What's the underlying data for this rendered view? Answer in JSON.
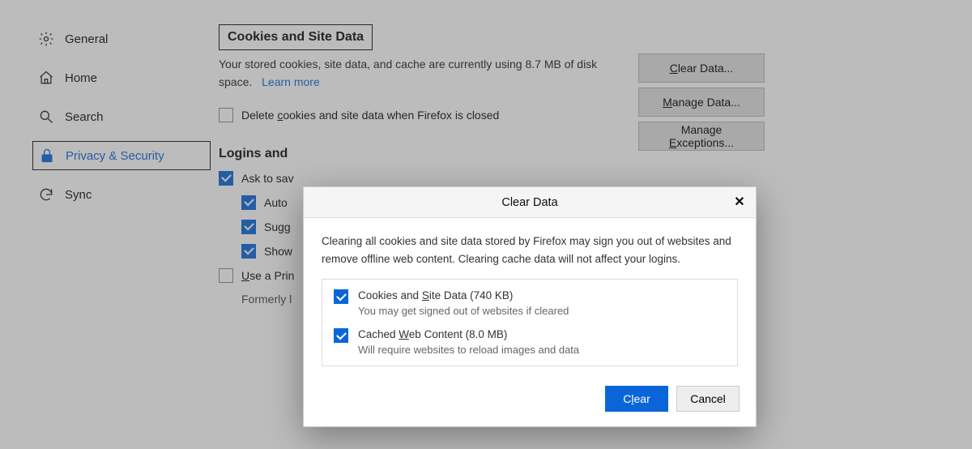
{
  "sidebar": {
    "general": "General",
    "home": "Home",
    "search": "Search",
    "privacy": "Privacy & Security",
    "sync": "Sync"
  },
  "cookies": {
    "heading": "Cookies and Site Data",
    "desc_pre": "Your stored cookies, site data, and cache are currently using 8.7 MB of disk space.",
    "learn_more": "Learn more",
    "delete_on_close_pre": "Delete ",
    "delete_on_close_u": "c",
    "delete_on_close_post": "ookies and site data when Firefox is closed",
    "clear_data_pre": "",
    "clear_data_u": "C",
    "clear_data_post": "lear Data...",
    "manage_data_pre": "",
    "manage_data_u": "M",
    "manage_data_post": "anage Data...",
    "manage_ex_pre": "Manage ",
    "manage_ex_u": "E",
    "manage_ex_post": "xceptions..."
  },
  "logins": {
    "heading": "Logins and",
    "ask": "Ask to sav",
    "autofill": "Auto",
    "suggest": "Sugg",
    "show": "Show",
    "use_primary_pre": "",
    "use_primary_u": "U",
    "use_primary_post": "se a Prin",
    "formerly": "Formerly l"
  },
  "dialog": {
    "title": "Clear Data",
    "intro": "Clearing all cookies and site data stored by Firefox may sign you out of websites and remove offline web content. Clearing cache data will not affect your logins.",
    "opt1_label_pre": "Cookies and ",
    "opt1_label_u": "S",
    "opt1_label_post": "ite Data (740 KB)",
    "opt1_sub": "You may get signed out of websites if cleared",
    "opt2_label_pre": "Cached ",
    "opt2_label_u": "W",
    "opt2_label_post": "eb Content (8.0 MB)",
    "opt2_sub": "Will require websites to reload images and data",
    "clear_pre": "C",
    "clear_u": "l",
    "clear_post": "ear",
    "cancel": "Cancel"
  }
}
